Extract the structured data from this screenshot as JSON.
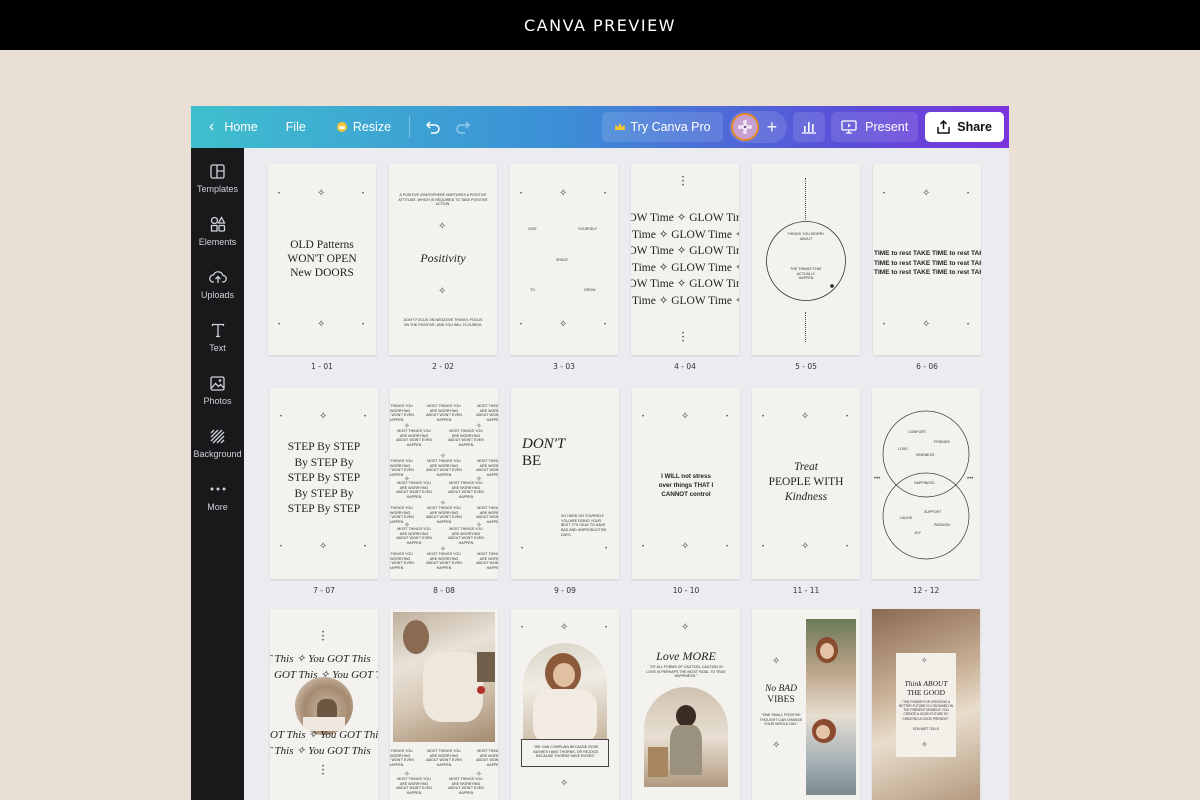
{
  "banner": {
    "title": "CANVA PREVIEW"
  },
  "toolbar": {
    "home": "Home",
    "file": "File",
    "resize": "Resize",
    "try_pro": "Try Canva Pro",
    "present": "Present",
    "share": "Share"
  },
  "sidebar": {
    "items": [
      {
        "label": "Templates",
        "icon": "templates-icon"
      },
      {
        "label": "Elements",
        "icon": "elements-icon"
      },
      {
        "label": "Uploads",
        "icon": "upload-icon"
      },
      {
        "label": "Text",
        "icon": "text-icon"
      },
      {
        "label": "Photos",
        "icon": "photos-icon"
      },
      {
        "label": "Background",
        "icon": "background-icon"
      },
      {
        "label": "More",
        "icon": "more-icon"
      }
    ]
  },
  "colors": {
    "accent_start": "#3fbfce",
    "accent_end": "#7b34dc",
    "sidebar": "#18191b",
    "page": "#f3f2ee"
  },
  "pages": [
    {
      "label": "1 - 01",
      "lines": [
        "OLD Patterns",
        "WON'T OPEN",
        "New DOORS"
      ]
    },
    {
      "label": "2 - 02",
      "headline": "Positivity",
      "top_text": "A POSITIVE ATMOSPHERE NURTURES A POSITIVE ATTITUDE, WHICH IS REQUIRED TO TAKE POSITIVE ACTION.",
      "bottom_text": "DON'T FOCUS ON NEGATIVE THINGS; FOCUS ON THE POSITIVE, AND YOU WILL FLOURISH."
    },
    {
      "label": "3 - 03",
      "words": [
        "GIVE",
        "YOURSELF",
        "SPACE",
        "TO",
        "GROW"
      ]
    },
    {
      "label": "4 - 04",
      "pattern": "GLOW Time ✧ GLOW Time ✧ GLOW"
    },
    {
      "label": "5 - 05",
      "top_text": "THINGS YOU WORRY ABOUT",
      "bottom_text": "THE THINGS THAT ACTUALLY HAPPEN"
    },
    {
      "label": "6 - 06",
      "pattern": "TIME to rest TAKE TIME to rest TAKE"
    },
    {
      "label": "7 - 07",
      "lines": [
        "STEP By STEP",
        "By STEP By",
        "STEP By STEP",
        "By STEP By",
        "STEP By STEP"
      ]
    },
    {
      "label": "8 - 08",
      "repeat_text": "MOST THINGS YOU ARE WORRYING ABOUT WON'T EVEN HAPPEN"
    },
    {
      "label": "9 - 09",
      "headline_1": "DON'T",
      "headline_2": "BE",
      "body": "SO HARD ON YOURSELF. YOU ARE DOING YOUR BEST. IT'S OKAY TO HAVE BAD AND UNPRODUCTIVE DAYS."
    },
    {
      "label": "10 - 10",
      "lines": [
        "I WILL not stress",
        "over things THAT I",
        "CANNOT control"
      ]
    },
    {
      "label": "11 - 11",
      "lines": [
        "Treat",
        "PEOPLE WITH",
        "Kindness"
      ]
    },
    {
      "label": "12 - 12",
      "words": [
        "COMFORT",
        "FRIENDS",
        "LOVE",
        "KINDNESS",
        "HAPPINESS",
        "SUPPORT",
        "LAUGH",
        "PASSION",
        "JOY"
      ]
    },
    {
      "label": "",
      "pattern": "GOT This ✧ You GOT This"
    },
    {
      "label": "",
      "repeat_text": "MOST THINGS YOU ARE WORRYING ABOUT WON'T EVEN HAPPEN"
    },
    {
      "label": "",
      "body": "\"WE CAN COMPLAIN BECAUSE ROSE BUSHES HAVE THORNS, OR REJOICE BECAUSE THORNS HAVE ROSES.\""
    },
    {
      "label": "",
      "headline": "Love MORE",
      "body": "\"OF ALL FORMS OF CAUTION, CAUTION IN LOVE IS PERHAPS THE MOST FATAL TO TRUE HAPPINESS.\""
    },
    {
      "label": "",
      "headline_1": "No BAD",
      "headline_2": "VIBES",
      "body": "\"ONE SMALL POSITIVE THOUGHT CAN CHANGE YOUR WHOLE DAY.\""
    },
    {
      "label": "",
      "headline_1": "Think ABOUT",
      "headline_2": "THE GOOD",
      "body": "\"THE POWER FOR CREATING A BETTER FUTURE IS CONTAINED IN THE PRESENT MOMENT: YOU CREATE A GOOD FUTURE BY CREATING A GOOD PRESENT.\"",
      "author": "ECKHART TOLLE"
    }
  ]
}
